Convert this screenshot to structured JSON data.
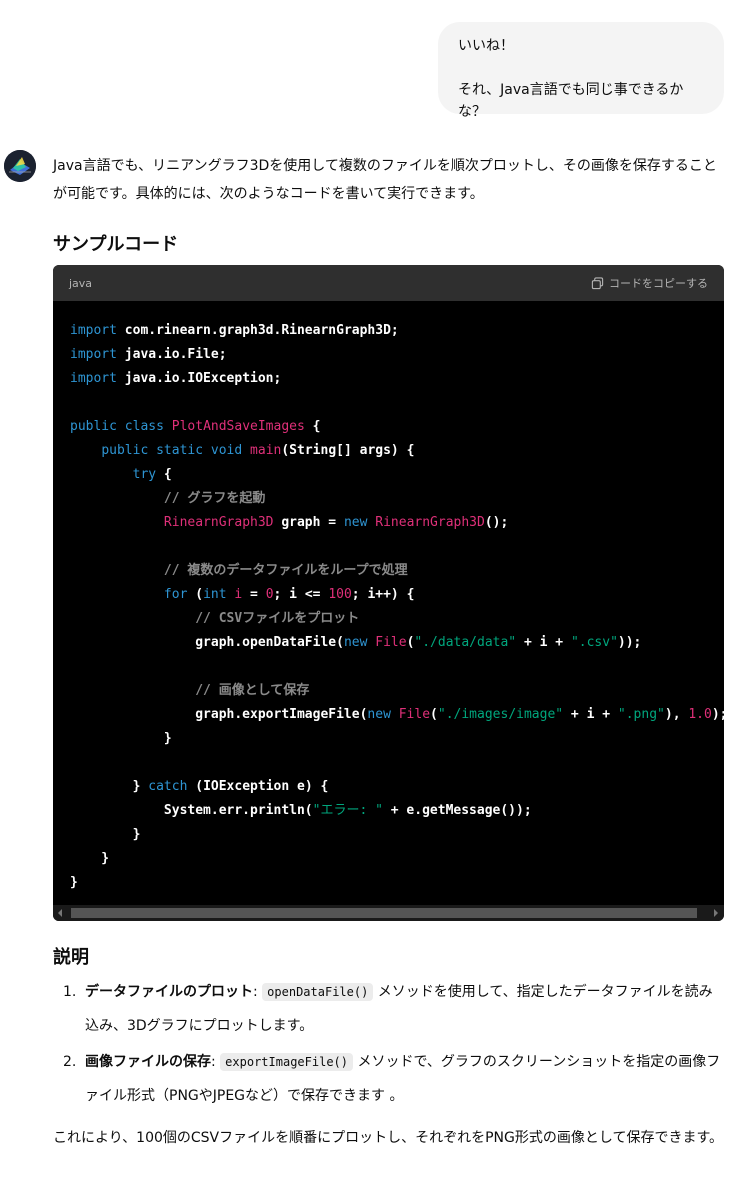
{
  "user_message": {
    "line1": "いいね！",
    "line2": "それ、Java言語でも同じ事できるかな？"
  },
  "assistant": {
    "avatar_icon": "assistant-avatar-icon",
    "intro": "Java言語でも、リニアングラフ3Dを使用して複数のファイルを順次プロットし、その画像を保存することが可能です。具体的には、次のようなコードを書いて実行できます。",
    "sample_heading": "サンプルコード",
    "code": {
      "language": "java",
      "copy_label": "コードをコピーする",
      "lines": [
        "import com.rinearn.graph3d.RinearnGraph3D;",
        "import java.io.File;",
        "import java.io.IOException;",
        "",
        "public class PlotAndSaveImages {",
        "    public static void main(String[] args) {",
        "        try {",
        "            // グラフを起動",
        "            RinearnGraph3D graph = new RinearnGraph3D();",
        "",
        "            // 複数のデータファイルをループで処理",
        "            for (int i = 0; i <= 100; i++) {",
        "                // CSVファイルをプロット",
        "                graph.openDataFile(new File(\"./data/data\" + i + \".csv\"));",
        "",
        "                // 画像として保存",
        "                graph.exportImageFile(new File(\"./images/image\" + i + \".png\"), 1.0);",
        "            }",
        "",
        "        } catch (IOException e) {",
        "            System.err.println(\"エラー: \" + e.getMessage());",
        "        }",
        "    }",
        "}"
      ]
    },
    "explain_heading": "説明",
    "items": [
      {
        "num": "1.",
        "title": "データファイルのプロット",
        "sep": ":",
        "code": "openDataFile()",
        "text": "メソッドを使用して、指定したデータファイルを読み込み、3Dグラフにプロットします。"
      },
      {
        "num": "2.",
        "title": "画像ファイルの保存",
        "sep": ":",
        "code": "exportImageFile()",
        "text": "メソッドで、グラフのスクリーンショットを指定の画像ファイル形式（PNGやJPEGなど）で保存できます 。"
      }
    ],
    "outro": "これにより、100個のCSVファイルを順番にプロットし、それぞれをPNG形式の画像として保存できます。"
  }
}
